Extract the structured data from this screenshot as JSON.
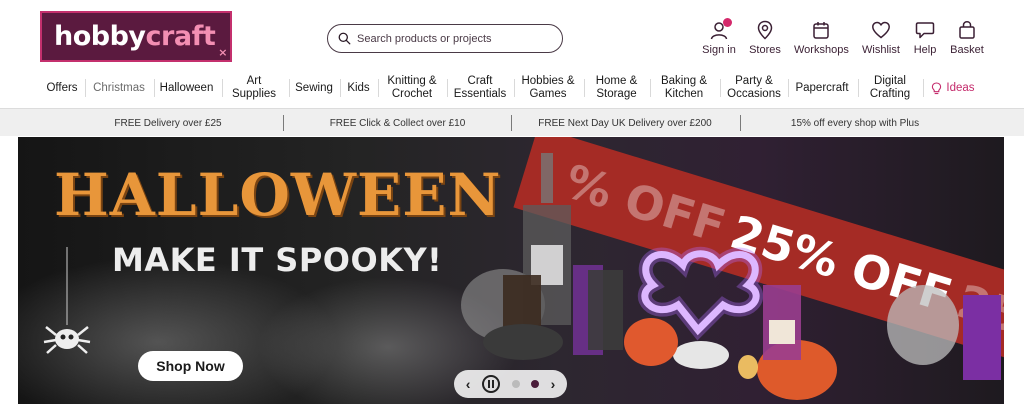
{
  "logo": {
    "part1": "hobby",
    "part2": "craft",
    "mark": "×"
  },
  "search": {
    "placeholder": "Search products or projects"
  },
  "header_icons": [
    {
      "label": "Sign in",
      "icon": "user-icon"
    },
    {
      "label": "Stores",
      "icon": "map-pin-icon"
    },
    {
      "label": "Workshops",
      "icon": "calendar-icon"
    },
    {
      "label": "Wishlist",
      "icon": "heart-icon"
    },
    {
      "label": "Help",
      "icon": "speech-bubble-icon"
    },
    {
      "label": "Basket",
      "icon": "basket-icon"
    }
  ],
  "nav": [
    {
      "label": "Offers"
    },
    {
      "label": "Christmas"
    },
    {
      "label": "Halloween"
    },
    {
      "label": "Art\nSupplies"
    },
    {
      "label": "Sewing"
    },
    {
      "label": "Kids"
    },
    {
      "label": "Knitting &\nCrochet"
    },
    {
      "label": "Craft\nEssentials"
    },
    {
      "label": "Hobbies &\nGames"
    },
    {
      "label": "Home &\nStorage"
    },
    {
      "label": "Baking &\nKitchen"
    },
    {
      "label": "Party &\nOccasions"
    },
    {
      "label": "Papercraft"
    },
    {
      "label": "Digital\nCrafting"
    },
    {
      "label": "Ideas"
    }
  ],
  "promo": [
    {
      "text": "FREE Delivery over £25"
    },
    {
      "text": "FREE Click & Collect over £10"
    },
    {
      "text": "FREE Next Day UK Delivery over £200"
    },
    {
      "text": "15% off every shop with Plus"
    }
  ],
  "hero": {
    "title": "HALLOWEEN",
    "subtitle": "MAKE IT SPOOKY!",
    "ribbon_text": "25% OFF",
    "ribbon_faded_left": "% OFF",
    "ribbon_faded_right": "25",
    "cta": "Shop Now"
  },
  "carousel": {
    "prev": "‹",
    "next": "›",
    "slides": 2,
    "active_slide": 2
  },
  "colors": {
    "brand": "#5b1a3f",
    "accent_pink": "#d4296b",
    "hero_orange": "#e8963a",
    "ribbon_red": "#a52b25"
  }
}
